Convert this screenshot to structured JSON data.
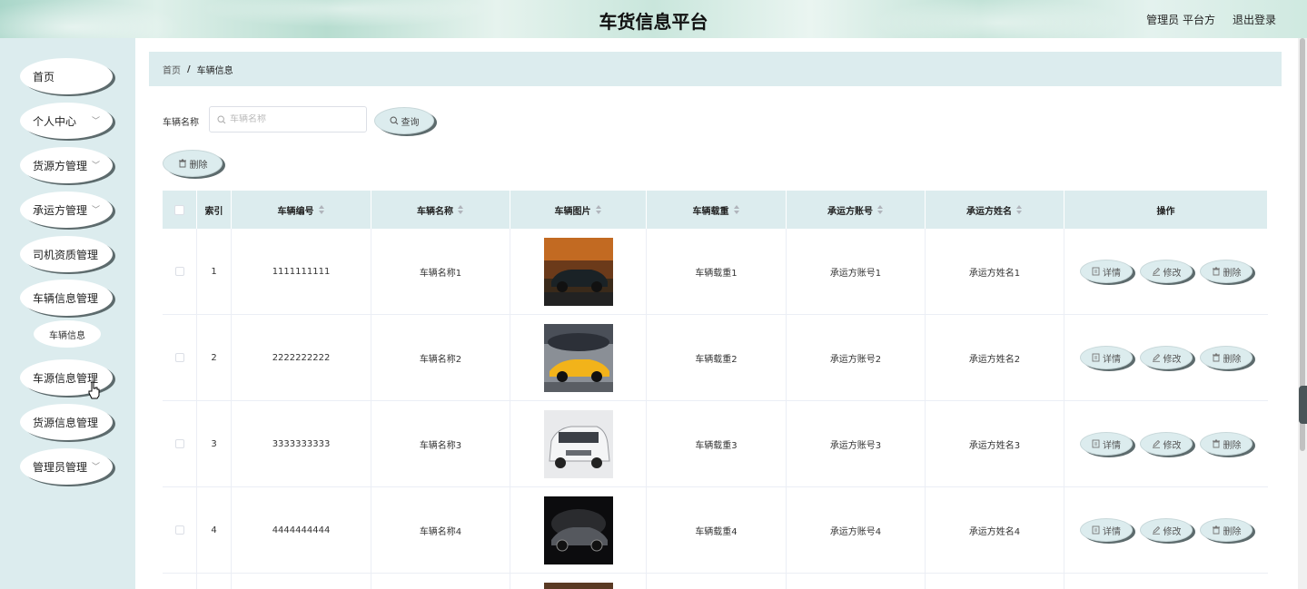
{
  "header": {
    "title": "车货信息平台",
    "user": "管理员 平台方",
    "logout": "退出登录"
  },
  "sidebar": {
    "items": [
      {
        "label": "首页",
        "has_sub": false
      },
      {
        "label": "个人中心",
        "has_sub": true
      },
      {
        "label": "货源方管理",
        "has_sub": true
      },
      {
        "label": "承运方管理",
        "has_sub": true
      },
      {
        "label": "司机资质管理",
        "has_sub": false
      },
      {
        "label": "车辆信息管理",
        "has_sub": false
      },
      {
        "label": "车源信息管理",
        "has_sub": false
      },
      {
        "label": "货源信息管理",
        "has_sub": false
      },
      {
        "label": "管理员管理",
        "has_sub": true
      }
    ],
    "sub_item": "车辆信息"
  },
  "breadcrumb": {
    "home": "首页",
    "sep": "/",
    "current": "车辆信息"
  },
  "search": {
    "label": "车辆名称",
    "placeholder": "车辆名称",
    "query_btn": "查询"
  },
  "toolbar": {
    "delete_btn": "删除"
  },
  "table": {
    "headers": [
      "索引",
      "车辆编号",
      "车辆名称",
      "车辆图片",
      "车辆载重",
      "承运方账号",
      "承运方姓名",
      "操作"
    ],
    "rows": [
      {
        "index": "1",
        "code": "1111111111",
        "name": "车辆名称1",
        "load": "车辆载重1",
        "account": "承运方账号1",
        "owner": "承运方姓名1"
      },
      {
        "index": "2",
        "code": "2222222222",
        "name": "车辆名称2",
        "load": "车辆载重2",
        "account": "承运方账号2",
        "owner": "承运方姓名2"
      },
      {
        "index": "3",
        "code": "3333333333",
        "name": "车辆名称3",
        "load": "车辆载重3",
        "account": "承运方账号3",
        "owner": "承运方姓名3"
      },
      {
        "index": "4",
        "code": "4444444444",
        "name": "车辆名称4",
        "load": "车辆载重4",
        "account": "承运方账号4",
        "owner": "承运方姓名4"
      }
    ],
    "actions": {
      "detail": "详情",
      "edit": "修改",
      "delete": "删除"
    }
  },
  "colors": {
    "accent_bg": "#dcecee",
    "shadow": "#5d6b6d"
  }
}
